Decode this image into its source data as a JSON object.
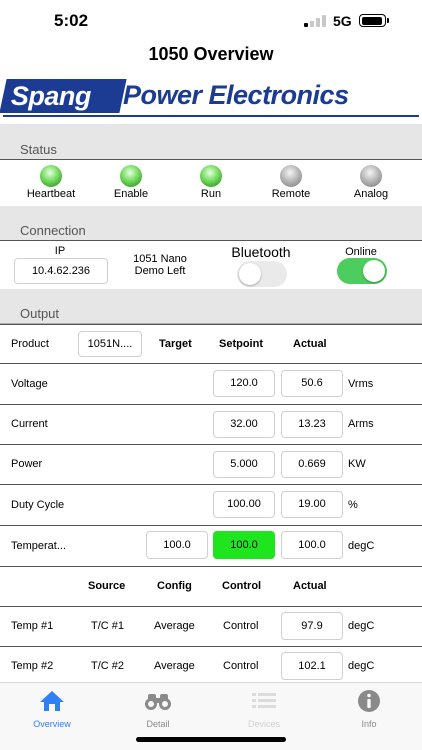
{
  "statusbar": {
    "time": "5:02",
    "network": "5G"
  },
  "nav": {
    "title": "1050 Overview"
  },
  "logo": {
    "brand": "Spang",
    "rest": "Power Electronics"
  },
  "status": {
    "title": "Status",
    "indicators": [
      {
        "label": "Heartbeat",
        "state": "on"
      },
      {
        "label": "Enable",
        "state": "on"
      },
      {
        "label": "Run",
        "state": "on"
      },
      {
        "label": "Remote",
        "state": "off"
      },
      {
        "label": "Analog",
        "state": "off"
      }
    ]
  },
  "connection": {
    "title": "Connection",
    "ip_label": "IP",
    "ip_value": "10.4.62.236",
    "device_name_line1": "1051 Nano",
    "device_name_line2": "Demo Left",
    "bluetooth_label": "Bluetooth",
    "bluetooth_on": false,
    "online_label": "Online",
    "online_on": true
  },
  "output": {
    "title": "Output",
    "product_label": "Product",
    "product_value": "1051N....",
    "headers": {
      "target": "Target",
      "setpoint": "Setpoint",
      "actual": "Actual"
    },
    "rows": [
      {
        "label": "Voltage",
        "setpoint": "120.0",
        "actual": "50.6",
        "unit": "Vrms"
      },
      {
        "label": "Current",
        "setpoint": "32.00",
        "actual": "13.23",
        "unit": "Arms"
      },
      {
        "label": "Power",
        "setpoint": "5.000",
        "actual": "0.669",
        "unit": "KW"
      },
      {
        "label": "Duty Cycle",
        "setpoint": "100.00",
        "actual": "19.00",
        "unit": "%"
      }
    ],
    "temperature": {
      "label": "Temperat...",
      "target": "100.0",
      "setpoint": "100.0",
      "actual": "100.0",
      "unit": "degC",
      "setpoint_color": "#1ee51e"
    }
  },
  "temps": {
    "headers": {
      "source": "Source",
      "config": "Config",
      "control": "Control",
      "actual": "Actual"
    },
    "rows": [
      {
        "label": "Temp #1",
        "source": "T/C #1",
        "config": "Average",
        "control": "Control",
        "actual": "97.9",
        "unit": "degC"
      },
      {
        "label": "Temp #2",
        "source": "T/C #2",
        "config": "Average",
        "control": "Control",
        "actual": "102.1",
        "unit": "degC"
      }
    ]
  },
  "tabs": [
    {
      "label": "Overview",
      "icon": "home-icon",
      "state": "active"
    },
    {
      "label": "Detail",
      "icon": "binoculars-icon",
      "state": "normal"
    },
    {
      "label": "Devices",
      "icon": "list-icon",
      "state": "disabled"
    },
    {
      "label": "Info",
      "icon": "info-icon",
      "state": "normal"
    }
  ],
  "colors": {
    "accent": "#2f7ff5",
    "brand": "#1b3c92",
    "online": "#4ccd5d",
    "led_on": "#5ecf4a",
    "led_off": "#a0a0a0"
  }
}
